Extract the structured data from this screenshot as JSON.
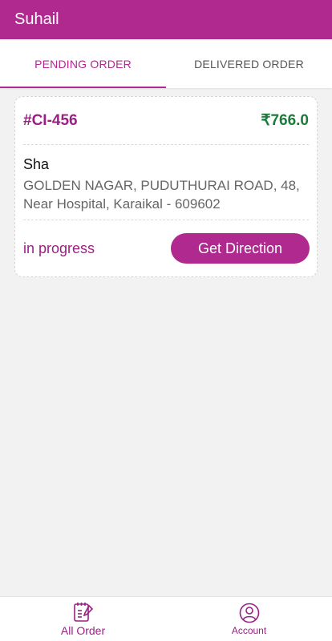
{
  "appbar": {
    "title": "Suhail"
  },
  "tabs": [
    {
      "label": "PENDING ORDER",
      "active": true
    },
    {
      "label": "DELIVERED ORDER",
      "active": false
    }
  ],
  "orders": [
    {
      "id": "#CI-456",
      "amount": "₹766.0",
      "customer_name": "Sha",
      "address": "GOLDEN NAGAR, PUDUTHURAI ROAD, 48, Near Hospital, Karaikal - 609602",
      "status": "in progress",
      "direction_label": "Get Direction"
    }
  ],
  "bottom_nav": [
    {
      "label": "All Order",
      "icon": "order-list-icon"
    },
    {
      "label": "Account",
      "icon": "account-icon"
    }
  ],
  "colors": {
    "primary": "#b0298e",
    "amount": "#1b7b3a",
    "background": "#f2f2f2"
  }
}
